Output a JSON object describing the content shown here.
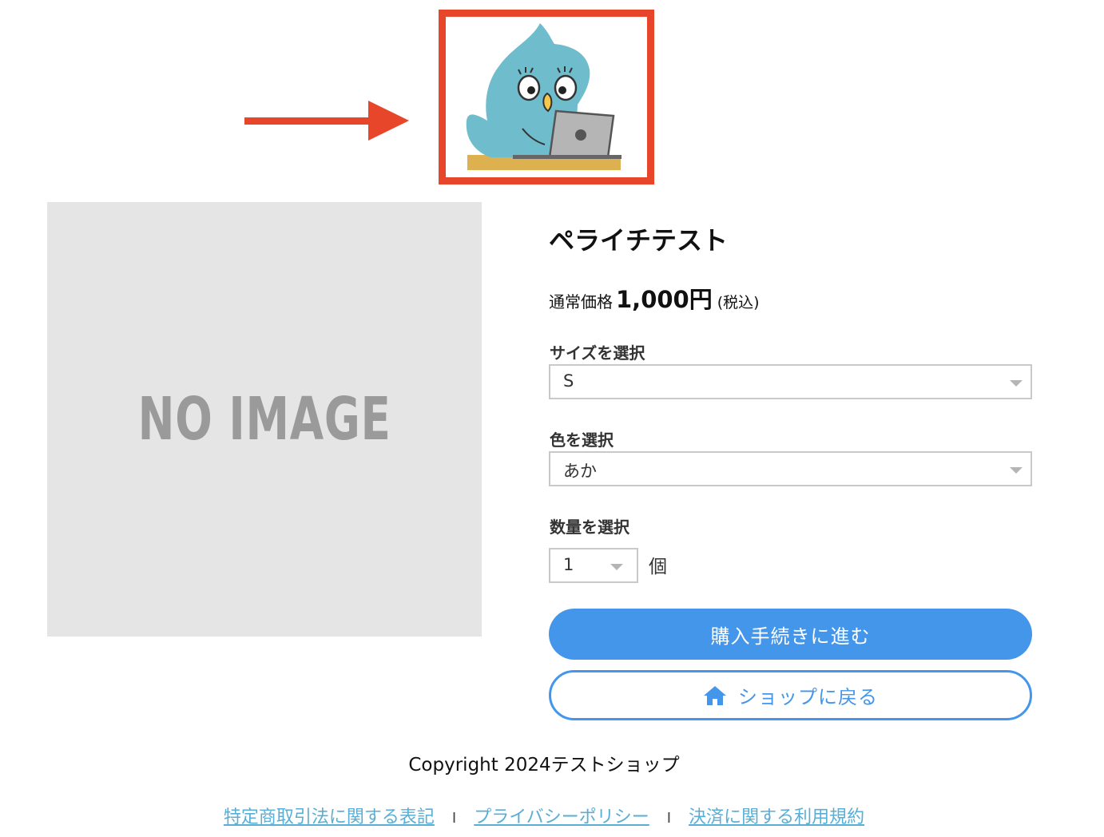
{
  "header": {
    "logo_alt": "bird-at-laptop-logo"
  },
  "product": {
    "image_placeholder": "NO IMAGE",
    "title": "ペライチテスト",
    "price_label": "通常価格",
    "price_value": "1,000円",
    "price_tax": "(税込)"
  },
  "options": {
    "size": {
      "label": "サイズを選択",
      "selected": "S"
    },
    "color": {
      "label": "色を選択",
      "selected": "あか"
    },
    "quantity": {
      "label": "数量を選択",
      "selected": "1",
      "unit": "個"
    }
  },
  "buttons": {
    "purchase": "購入手続きに進む",
    "back_to_shop": "ショップに戻る"
  },
  "footer": {
    "copyright": "Copyright 2024テストショップ",
    "links": [
      "特定商取引法に関する表記",
      "プライバシーポリシー",
      "決済に関する利用規約"
    ],
    "separator": "I"
  },
  "colors": {
    "accent": "#4496ea",
    "annotation": "#e8462b",
    "link": "#5aaed6",
    "placeholder_bg": "#e5e5e5"
  },
  "icons": {
    "arrow": "right-arrow-icon",
    "home": "home-icon",
    "caret": "chevron-down-icon"
  }
}
